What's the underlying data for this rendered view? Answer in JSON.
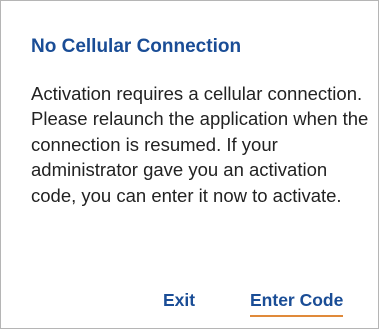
{
  "dialog": {
    "title": "No Cellular Connection",
    "message": "Activation requires a cellular connection. Please relaunch the application when the connection is resumed. If your administrator gave you an activation code, you can enter it now to activate.",
    "buttons": {
      "exit_label": "Exit",
      "enter_code_label": "Enter Code"
    },
    "colors": {
      "accent": "#1a4d96",
      "focus_underline": "#e08a3a"
    }
  }
}
